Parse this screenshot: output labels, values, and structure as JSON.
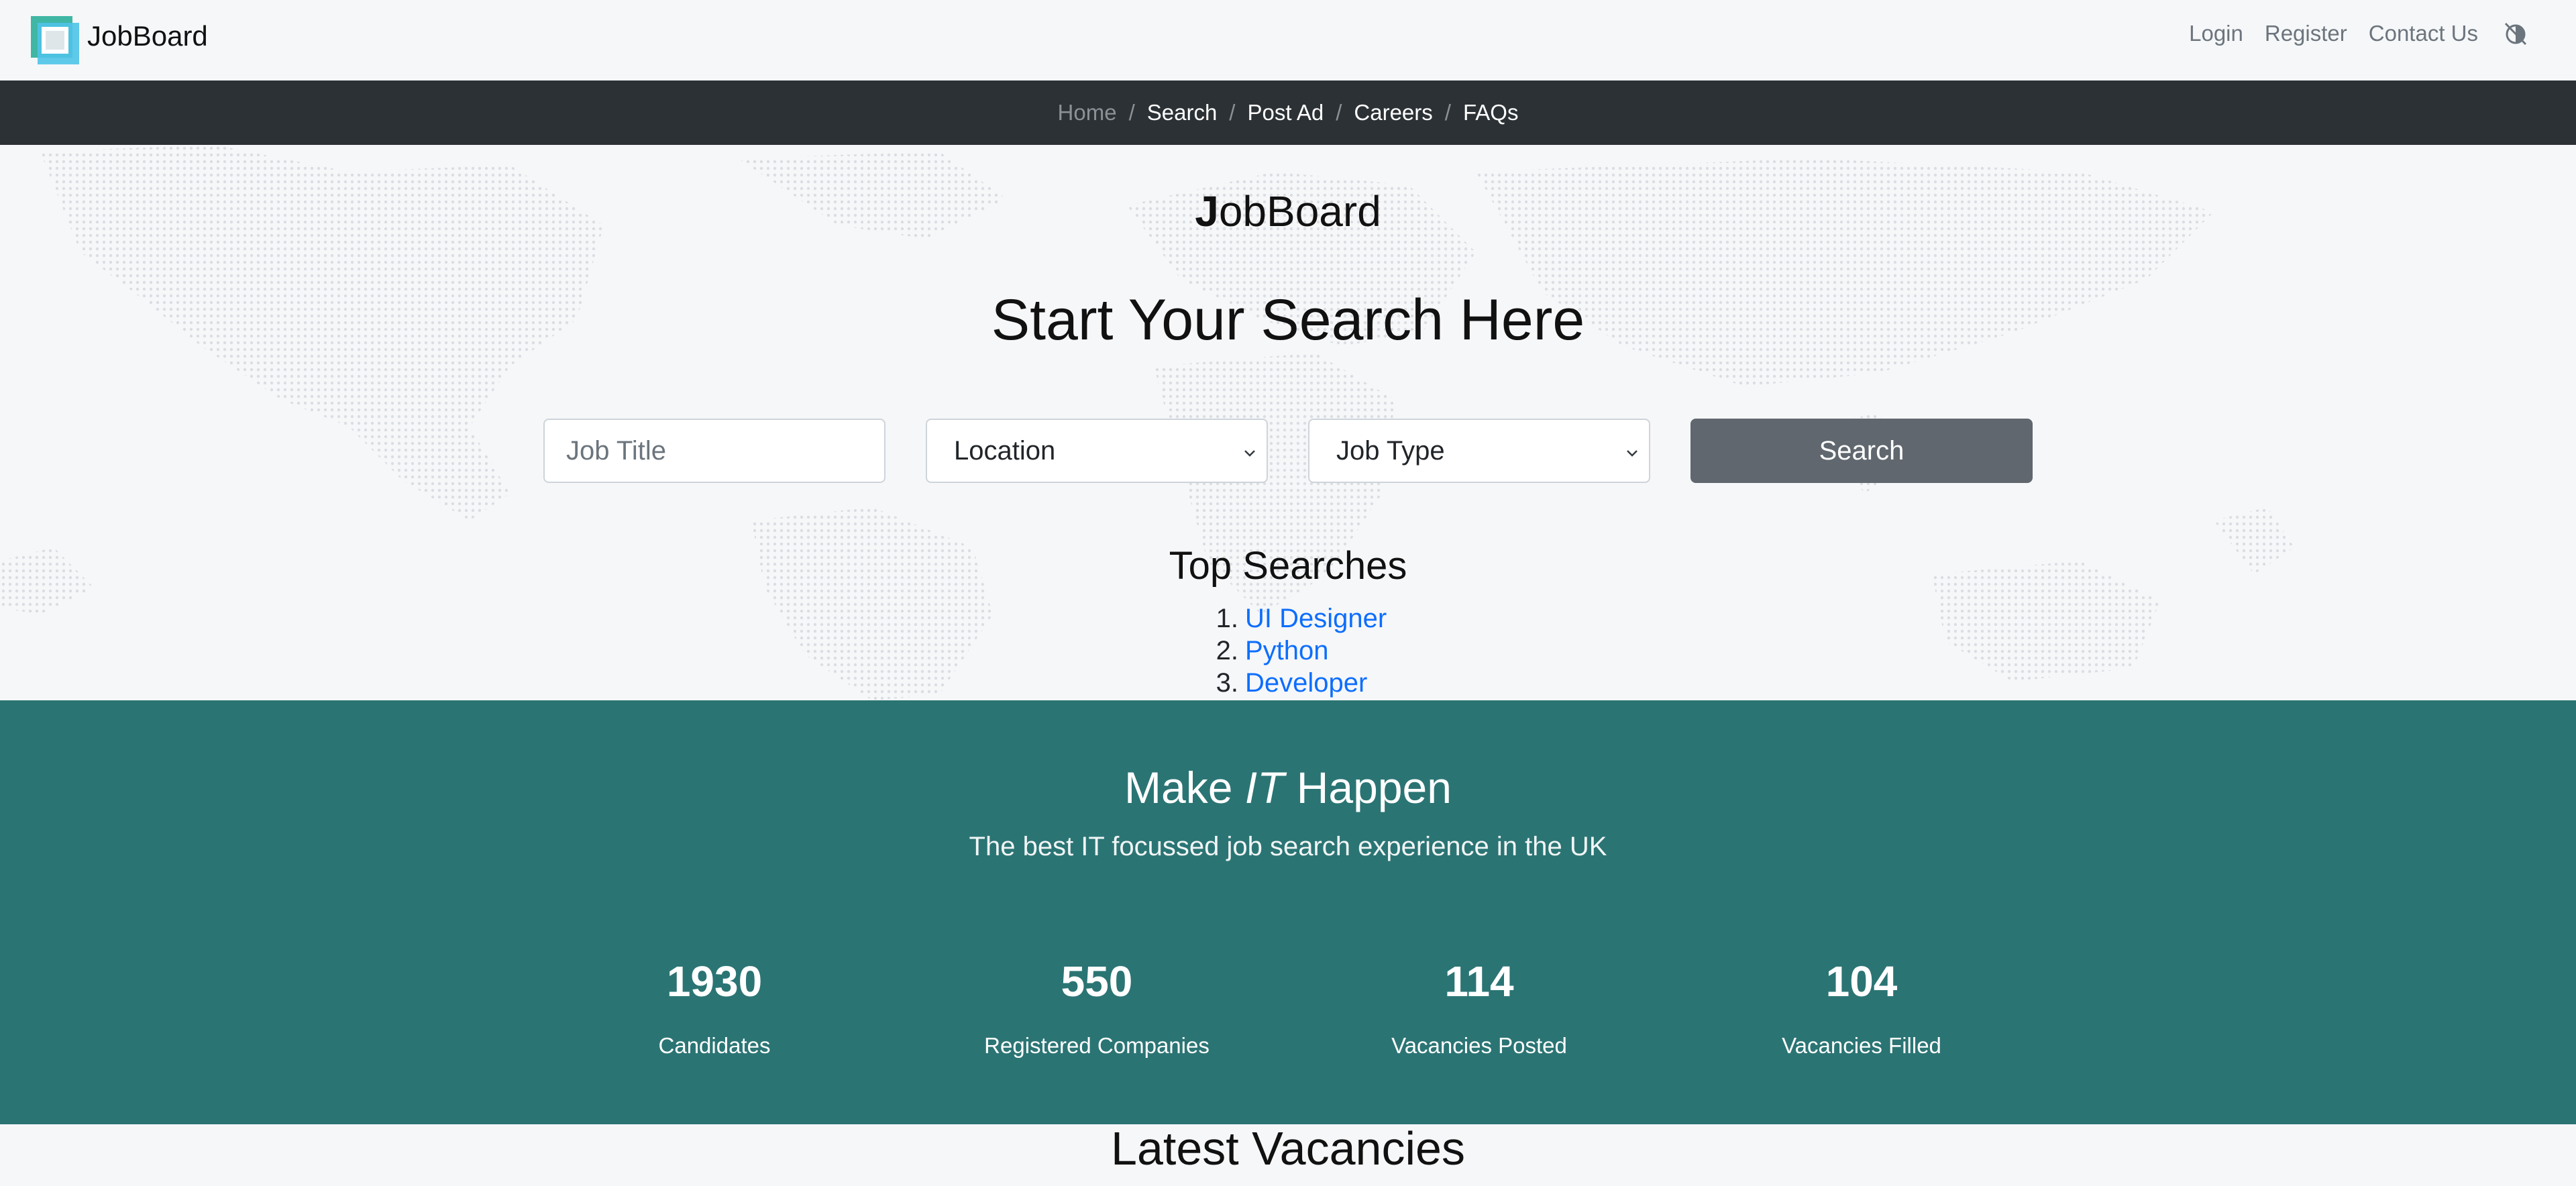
{
  "navbar": {
    "brand": "JobBoard",
    "links": [
      "Login",
      "Register",
      "Contact Us"
    ],
    "contrast_icon": "contrast-off-icon"
  },
  "breadcrumb": {
    "items": [
      "Home",
      "Search",
      "Post Ad",
      "Careers",
      "FAQs"
    ]
  },
  "hero": {
    "brand_initial": "J",
    "brand_rest": "obBoard",
    "title": "Start Your Search Here",
    "job_title_placeholder": "Job Title",
    "location_value": "Location",
    "job_type_value": "Job Type",
    "search_label": "Search",
    "top_searches_title": "Top Searches",
    "top_searches": [
      {
        "num": "1.",
        "label": "UI Designer"
      },
      {
        "num": "2.",
        "label": "Python"
      },
      {
        "num": "3.",
        "label": "Developer"
      }
    ]
  },
  "band": {
    "title_pre": "Make",
    "title_em": "IT",
    "title_post": "Happen",
    "subtitle": "The best IT focussed job search experience in the UK",
    "stats": [
      {
        "value": "1930",
        "label": "Candidates"
      },
      {
        "value": "550",
        "label": "Registered Companies"
      },
      {
        "value": "114",
        "label": "Vacancies Posted"
      },
      {
        "value": "104",
        "label": "Vacancies Filled"
      }
    ],
    "color": "#2b7474"
  },
  "latest_title": "Latest Vacancies"
}
